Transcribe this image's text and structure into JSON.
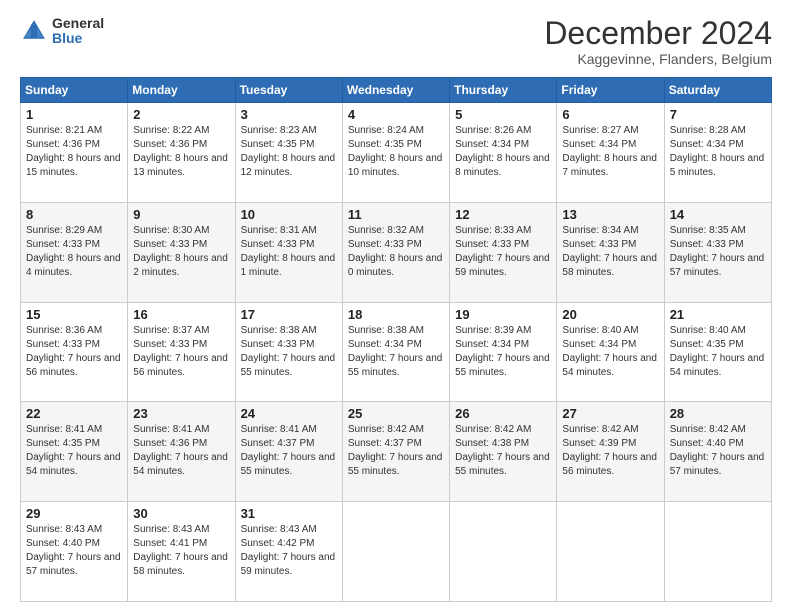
{
  "logo": {
    "general": "General",
    "blue": "Blue"
  },
  "title": "December 2024",
  "subtitle": "Kaggevinne, Flanders, Belgium",
  "days_header": [
    "Sunday",
    "Monday",
    "Tuesday",
    "Wednesday",
    "Thursday",
    "Friday",
    "Saturday"
  ],
  "weeks": [
    [
      {
        "day": "1",
        "sunrise": "8:21 AM",
        "sunset": "4:36 PM",
        "daylight": "8 hours and 15 minutes."
      },
      {
        "day": "2",
        "sunrise": "8:22 AM",
        "sunset": "4:36 PM",
        "daylight": "8 hours and 13 minutes."
      },
      {
        "day": "3",
        "sunrise": "8:23 AM",
        "sunset": "4:35 PM",
        "daylight": "8 hours and 12 minutes."
      },
      {
        "day": "4",
        "sunrise": "8:24 AM",
        "sunset": "4:35 PM",
        "daylight": "8 hours and 10 minutes."
      },
      {
        "day": "5",
        "sunrise": "8:26 AM",
        "sunset": "4:34 PM",
        "daylight": "8 hours and 8 minutes."
      },
      {
        "day": "6",
        "sunrise": "8:27 AM",
        "sunset": "4:34 PM",
        "daylight": "8 hours and 7 minutes."
      },
      {
        "day": "7",
        "sunrise": "8:28 AM",
        "sunset": "4:34 PM",
        "daylight": "8 hours and 5 minutes."
      }
    ],
    [
      {
        "day": "8",
        "sunrise": "8:29 AM",
        "sunset": "4:33 PM",
        "daylight": "8 hours and 4 minutes."
      },
      {
        "day": "9",
        "sunrise": "8:30 AM",
        "sunset": "4:33 PM",
        "daylight": "8 hours and 2 minutes."
      },
      {
        "day": "10",
        "sunrise": "8:31 AM",
        "sunset": "4:33 PM",
        "daylight": "8 hours and 1 minute."
      },
      {
        "day": "11",
        "sunrise": "8:32 AM",
        "sunset": "4:33 PM",
        "daylight": "8 hours and 0 minutes."
      },
      {
        "day": "12",
        "sunrise": "8:33 AM",
        "sunset": "4:33 PM",
        "daylight": "7 hours and 59 minutes."
      },
      {
        "day": "13",
        "sunrise": "8:34 AM",
        "sunset": "4:33 PM",
        "daylight": "7 hours and 58 minutes."
      },
      {
        "day": "14",
        "sunrise": "8:35 AM",
        "sunset": "4:33 PM",
        "daylight": "7 hours and 57 minutes."
      }
    ],
    [
      {
        "day": "15",
        "sunrise": "8:36 AM",
        "sunset": "4:33 PM",
        "daylight": "7 hours and 56 minutes."
      },
      {
        "day": "16",
        "sunrise": "8:37 AM",
        "sunset": "4:33 PM",
        "daylight": "7 hours and 56 minutes."
      },
      {
        "day": "17",
        "sunrise": "8:38 AM",
        "sunset": "4:33 PM",
        "daylight": "7 hours and 55 minutes."
      },
      {
        "day": "18",
        "sunrise": "8:38 AM",
        "sunset": "4:34 PM",
        "daylight": "7 hours and 55 minutes."
      },
      {
        "day": "19",
        "sunrise": "8:39 AM",
        "sunset": "4:34 PM",
        "daylight": "7 hours and 55 minutes."
      },
      {
        "day": "20",
        "sunrise": "8:40 AM",
        "sunset": "4:34 PM",
        "daylight": "7 hours and 54 minutes."
      },
      {
        "day": "21",
        "sunrise": "8:40 AM",
        "sunset": "4:35 PM",
        "daylight": "7 hours and 54 minutes."
      }
    ],
    [
      {
        "day": "22",
        "sunrise": "8:41 AM",
        "sunset": "4:35 PM",
        "daylight": "7 hours and 54 minutes."
      },
      {
        "day": "23",
        "sunrise": "8:41 AM",
        "sunset": "4:36 PM",
        "daylight": "7 hours and 54 minutes."
      },
      {
        "day": "24",
        "sunrise": "8:41 AM",
        "sunset": "4:37 PM",
        "daylight": "7 hours and 55 minutes."
      },
      {
        "day": "25",
        "sunrise": "8:42 AM",
        "sunset": "4:37 PM",
        "daylight": "7 hours and 55 minutes."
      },
      {
        "day": "26",
        "sunrise": "8:42 AM",
        "sunset": "4:38 PM",
        "daylight": "7 hours and 55 minutes."
      },
      {
        "day": "27",
        "sunrise": "8:42 AM",
        "sunset": "4:39 PM",
        "daylight": "7 hours and 56 minutes."
      },
      {
        "day": "28",
        "sunrise": "8:42 AM",
        "sunset": "4:40 PM",
        "daylight": "7 hours and 57 minutes."
      }
    ],
    [
      {
        "day": "29",
        "sunrise": "8:43 AM",
        "sunset": "4:40 PM",
        "daylight": "7 hours and 57 minutes."
      },
      {
        "day": "30",
        "sunrise": "8:43 AM",
        "sunset": "4:41 PM",
        "daylight": "7 hours and 58 minutes."
      },
      {
        "day": "31",
        "sunrise": "8:43 AM",
        "sunset": "4:42 PM",
        "daylight": "7 hours and 59 minutes."
      },
      null,
      null,
      null,
      null
    ]
  ]
}
